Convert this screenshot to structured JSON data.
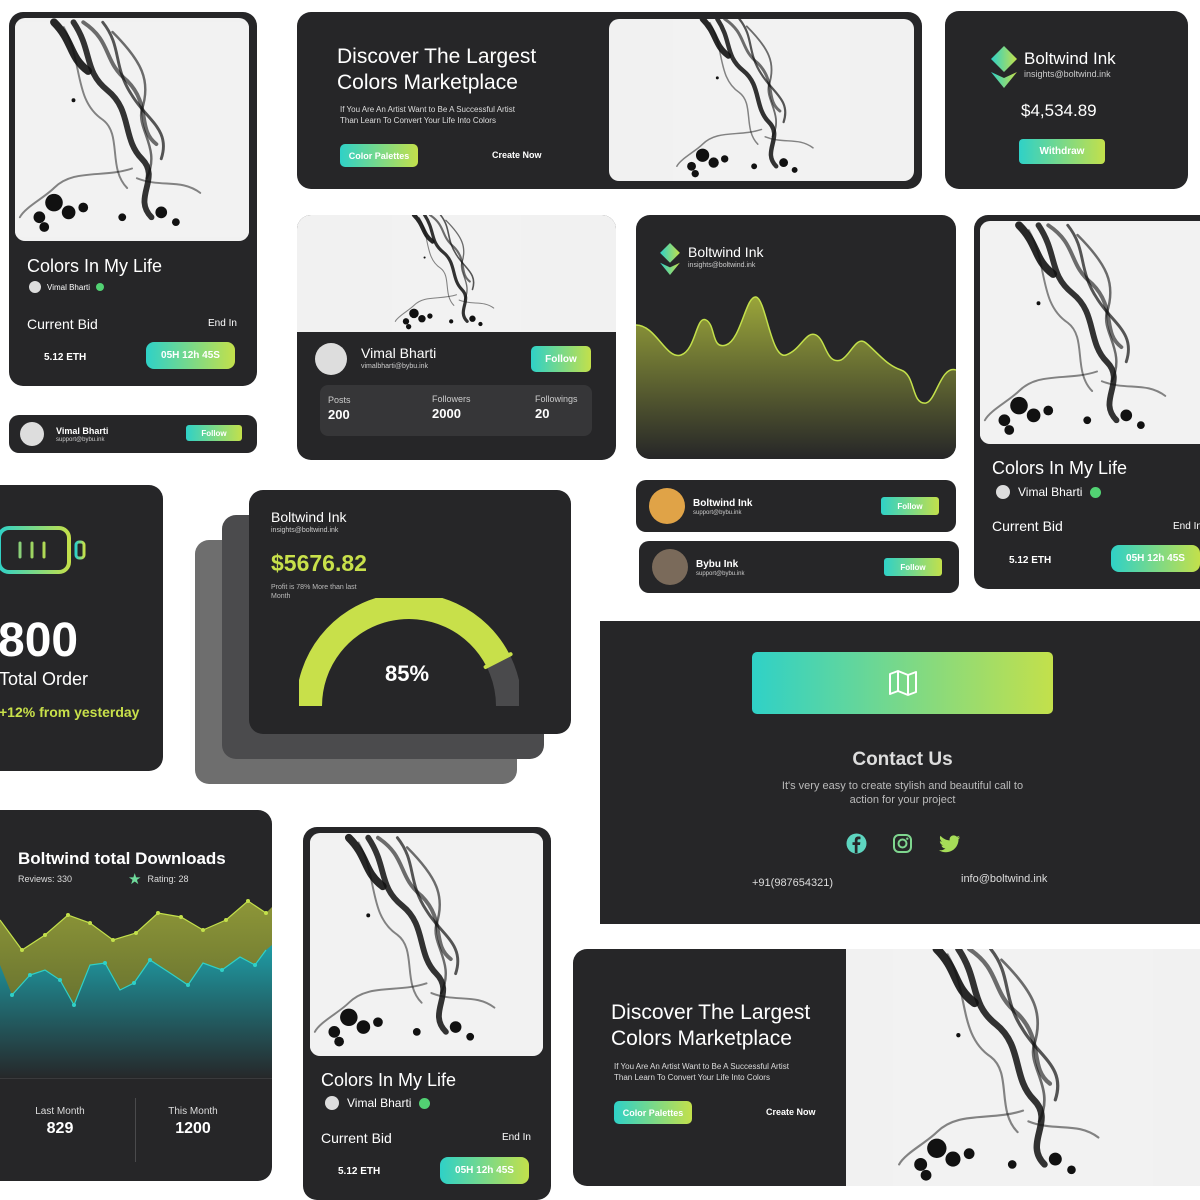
{
  "colors": {
    "card": "#262628",
    "accent_teal": "#2fd1c7",
    "accent_lime": "#c3e04b",
    "lime_text": "#c8e04a"
  },
  "nft": {
    "title": "Colors In My Life",
    "author": "Vimal Bharti",
    "current_bid_label": "Current Bid",
    "end_in_label": "End In",
    "bid_value": "5.12 ETH",
    "timer": "05H 12h 45S"
  },
  "hero": {
    "title_line1": "Discover The Largest",
    "title_line2": "Colors Marketplace",
    "sub_line1": "If You Are An Artist Want to Be A Successful Artist",
    "sub_line2": "Than Learn To Convert Your Life Into Colors",
    "primary_btn": "Color Palettes",
    "secondary_btn": "Create Now"
  },
  "wallet": {
    "brand": "Boltwind Ink",
    "email": "insights@boltwind.ink",
    "balance": "$4,534.89",
    "withdraw": "Withdraw"
  },
  "follow_small": {
    "name": "Vimal Bharti",
    "email": "support@bybu.ink",
    "follow": "Follow"
  },
  "profile": {
    "name": "Vimal Bharti",
    "email": "vimalbharti@bybu.ink",
    "follow": "Follow",
    "stats": [
      {
        "label": "Posts",
        "value": "200"
      },
      {
        "label": "Followers",
        "value": "2000"
      },
      {
        "label": "Followings",
        "value": "20"
      }
    ]
  },
  "area_card": {
    "brand": "Boltwind Ink",
    "email": "insights@boltwind.ink"
  },
  "users": [
    {
      "name": "Boltwind Ink",
      "email": "support@bybu.ink",
      "follow": "Follow"
    },
    {
      "name": "Bybu Ink",
      "email": "support@bybu.ink",
      "follow": "Follow"
    }
  ],
  "orders": {
    "value": "800",
    "label": "Total Order",
    "change": "+12% from yesterday"
  },
  "profit": {
    "brand": "Boltwind Ink",
    "email": "insights@boltwind.ink",
    "amount": "$5676.82",
    "note_line1": "Profit is 78% More than last",
    "note_line2": "Month",
    "percent_label": "85%",
    "percent": 85
  },
  "contact": {
    "title": "Contact Us",
    "desc_line1": "It's very easy to create stylish and beautiful call to",
    "desc_line2": "action for your project",
    "phone": "+91(987654321)",
    "email": "info@boltwind.ink"
  },
  "downloads": {
    "title": "Boltwind total Downloads",
    "reviews": "Reviews: 330",
    "rating": "Rating: 28",
    "last_label": "Last Month",
    "last_value": "829",
    "this_label": "This Month",
    "this_value": "1200"
  }
}
